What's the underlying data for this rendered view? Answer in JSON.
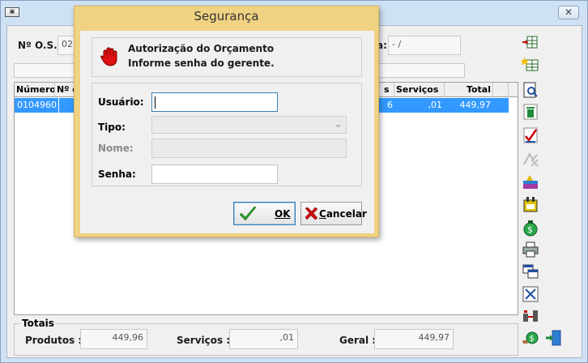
{
  "window": {
    "app_icon": "app-logo-icon",
    "close_glyph": "✕"
  },
  "header": {
    "os_label": "Nº O.S.:",
    "os_value": "02",
    "date_label_partial": "a:",
    "date_value": " -  /"
  },
  "grid": {
    "columns": [
      "Número",
      "Nº de",
      "s",
      "Serviços",
      "Total"
    ],
    "rows": [
      {
        "numero": "0104960",
        "partial": "6",
        "servicos": ",01",
        "total": "449,97"
      }
    ]
  },
  "totais": {
    "title": "Totais",
    "produtos_label": "Produtos :",
    "produtos_value": "449,96",
    "servicos_label": "Serviços :",
    "servicos_value": ",01",
    "geral_label": "Geral :",
    "geral_value": "449,97"
  },
  "toolbar": {
    "icons": [
      "insert-row-icon",
      "new-grid-icon",
      "preview-icon",
      "delete-icon",
      "approve-icon",
      "disabled-tool-icon",
      "edit-picture-icon",
      "calendar-icon",
      "money-icon",
      "print-icon",
      "copy-window-icon",
      "split-icon",
      "transfer-icon",
      "money-hand-icon",
      "exit-door-icon"
    ]
  },
  "dialog": {
    "title": "Segurança",
    "auth_line1": "Autorização do Orçamento",
    "auth_line2": "Informe senha do gerente.",
    "usuario_label": "Usuário:",
    "usuario_value": "",
    "tipo_label": "Tipo:",
    "tipo_value": "",
    "nome_label": "Nome:",
    "nome_value": "",
    "senha_label": "Senha:",
    "senha_value": "",
    "ok_label": "OK",
    "cancel_label": "Cancelar"
  }
}
